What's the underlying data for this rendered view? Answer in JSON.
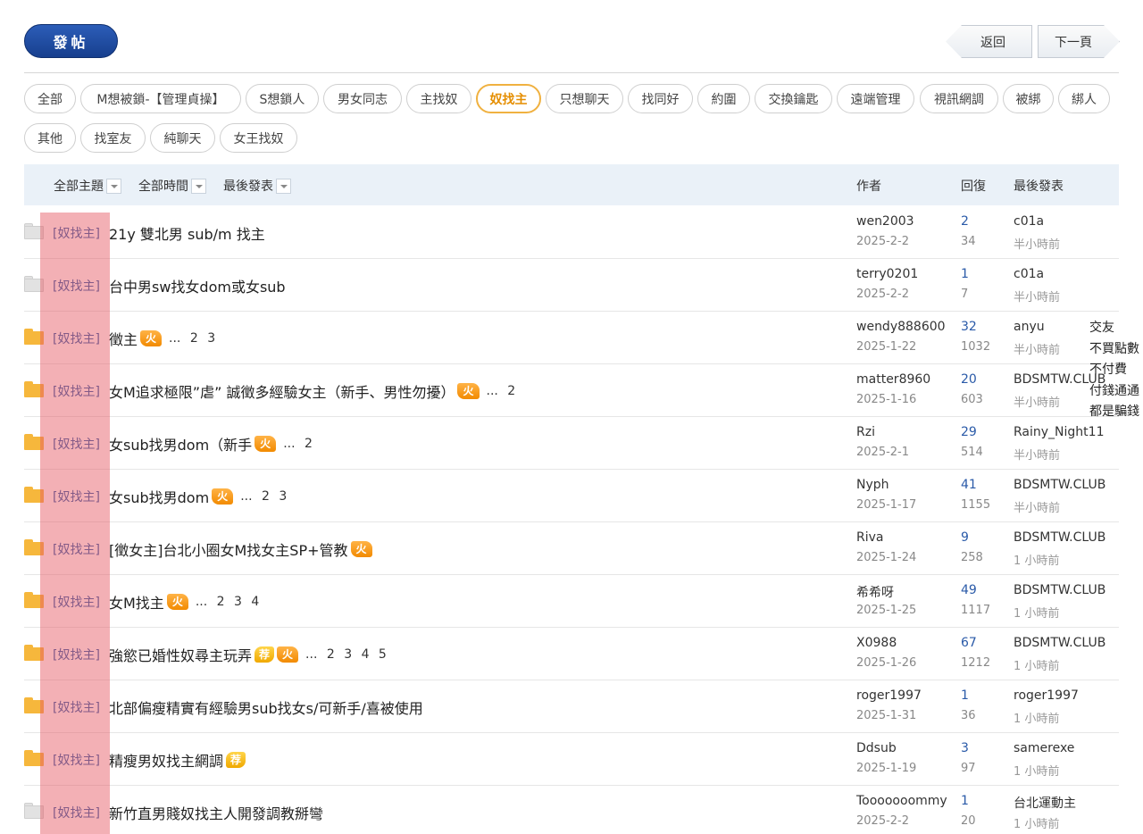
{
  "toolbar": {
    "post_label": "發帖",
    "back_label": "返回",
    "next_label": "下一頁"
  },
  "tags": [
    "全部",
    "M想被鎖-【管理貞操】",
    "S想鎖人",
    "男女同志",
    "主找奴",
    "奴找主",
    "只想聊天",
    "找同好",
    "約圍",
    "交換鑰匙",
    "遠端管理",
    "視訊網調",
    "被綁",
    "綁人",
    "其他",
    "找室友",
    "純聊天",
    "女王找奴"
  ],
  "active_tag": "奴找主",
  "list_header": {
    "filter_topics": "全部主題",
    "filter_time": "全部時間",
    "filter_sort": "最後發表",
    "col_author": "作者",
    "col_replies": "回復",
    "col_last": "最後發表"
  },
  "icons": {
    "hot_folder": "folder-hot-icon",
    "cold_folder": "folder-icon",
    "fire_badge": "fire-icon",
    "recommend_badge": "recommend-icon"
  },
  "colors": {
    "accent": "#2a5aa8",
    "active_tag": "#f0b140",
    "header_bg": "#eaf1f8",
    "post_button": "#1f4a9e"
  },
  "threads": [
    {
      "category": "[奴找主]",
      "title": "21y 雙北男 sub/m 找主",
      "hot": false,
      "fire": "",
      "rec": "",
      "pages": "",
      "author": "wen2003",
      "date": "2025-2-2",
      "replies": "2",
      "views": "34",
      "last_user": "c01a",
      "last_time": "半小時前"
    },
    {
      "category": "[奴找主]",
      "title": "台中男sw找女dom或女sub",
      "hot": false,
      "fire": "",
      "rec": "",
      "pages": "",
      "author": "terry0201",
      "date": "2025-2-2",
      "replies": "1",
      "views": "7",
      "last_user": "c01a",
      "last_time": "半小時前"
    },
    {
      "category": "[奴找主]",
      "title": "徵主",
      "hot": true,
      "fire": "火",
      "rec": "",
      "pages": "... 2 3",
      "author": "wendy888600",
      "date": "2025-1-22",
      "replies": "32",
      "views": "1032",
      "last_user": "anyu",
      "last_time": "半小時前"
    },
    {
      "category": "[奴找主]",
      "title": "女M追求極限”虐” 誠徵多經驗女主（新手、男性勿擾）",
      "hot": true,
      "fire": "火",
      "rec": "",
      "pages": "... 2",
      "author": "matter8960",
      "date": "2025-1-16",
      "replies": "20",
      "views": "603",
      "last_user": "BDSMTW.CLUB",
      "last_time": "半小時前"
    },
    {
      "category": "[奴找主]",
      "title": "女sub找男dom（新手",
      "hot": true,
      "fire": "火",
      "rec": "",
      "pages": "... 2",
      "author": "Rzi",
      "date": "2025-2-1",
      "replies": "29",
      "views": "514",
      "last_user": "Rainy_Night11",
      "last_time": "半小時前"
    },
    {
      "category": "[奴找主]",
      "title": "女sub找男dom",
      "hot": true,
      "fire": "火",
      "rec": "",
      "pages": "... 2 3",
      "author": "Nyph",
      "date": "2025-1-17",
      "replies": "41",
      "views": "1155",
      "last_user": "BDSMTW.CLUB",
      "last_time": "半小時前"
    },
    {
      "category": "[奴找主]",
      "title": " [徵女主]台北小圈女M找女主SP+管教",
      "hot": true,
      "fire": "火",
      "rec": "",
      "pages": "",
      "author": "Riva",
      "date": "2025-1-24",
      "replies": "9",
      "views": "258",
      "last_user": "BDSMTW.CLUB",
      "last_time": "1 小時前"
    },
    {
      "category": "[奴找主]",
      "title": "女M找主",
      "hot": true,
      "fire": "火",
      "rec": "",
      "pages": "... 2 3 4",
      "author": "希希呀",
      "date": "2025-1-25",
      "replies": "49",
      "views": "1117",
      "last_user": "BDSMTW.CLUB",
      "last_time": "1 小時前"
    },
    {
      "category": "[奴找主]",
      "title": "強慾已婚性奴尋主玩弄",
      "hot": true,
      "fire": "火",
      "rec": "荐",
      "pages": "... 2 3 4 5",
      "author": "X0988",
      "date": "2025-1-26",
      "replies": "67",
      "views": "1212",
      "last_user": "BDSMTW.CLUB",
      "last_time": "1 小時前"
    },
    {
      "category": "[奴找主]",
      "title": "北部偏瘦精實有經驗男sub找女s/可新手/喜被使用",
      "hot": true,
      "fire": "",
      "rec": "",
      "pages": "",
      "author": "roger1997",
      "date": "2025-1-31",
      "replies": "1",
      "views": "36",
      "last_user": "roger1997",
      "last_time": "1 小時前"
    },
    {
      "category": "[奴找主]",
      "title": "精瘦男奴找主網調",
      "hot": true,
      "fire": "",
      "rec": "荐",
      "pages": "",
      "author": "Ddsub",
      "date": "2025-1-19",
      "replies": "3",
      "views": "97",
      "last_user": "samerexe",
      "last_time": "1 小時前"
    },
    {
      "category": "[奴找主]",
      "title": "新竹直男賤奴找主人開發調教掰彎",
      "hot": false,
      "fire": "",
      "rec": "",
      "pages": "",
      "author": "Tooooooommy",
      "date": "2025-2-2",
      "replies": "1",
      "views": "20",
      "last_user": "台北運動主",
      "last_time": "1 小時前"
    }
  ],
  "side_note": [
    "交友",
    "不買點數",
    "不付費",
    "付錢通通",
    "都是騙錢"
  ]
}
